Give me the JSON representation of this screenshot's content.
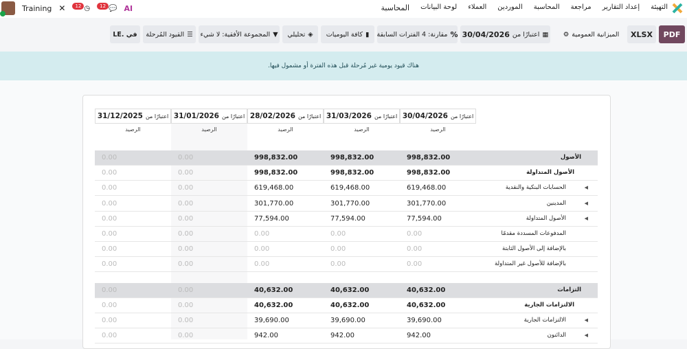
{
  "nav": {
    "app": "المحاسبة",
    "items": [
      "لوحة البيانات",
      "العملاء",
      "الموردين",
      "المحاسبة",
      "مراجعة",
      "إعداد التقارير",
      "التهيئة"
    ]
  },
  "systray": {
    "company": "Training",
    "activity_count": "12",
    "messages_count": "12",
    "ai": "AI"
  },
  "controls": {
    "pdf": "PDF",
    "xlsx": "XLSX",
    "report": "الميزانية العمومية",
    "date": "30/04/2026",
    "date_prefix": "اعتبارًا من",
    "comparison": "مقارنة: 4 الفترات السابقة",
    "journals": "كافة اليوميات",
    "analytic": "تحليلي",
    "horizontal_group": "المجموعة الأفقية: لا شيء",
    "posted": "القيود المُرحلة",
    "currency": "في .LE"
  },
  "banner": "هناك قيود يومية غير مُرحلة قبل هذه الفترة أو مشمول فيها.",
  "columns": [
    {
      "prefix": "اعتبارًا من",
      "date": "30/04/2026",
      "sub": "الرصيد"
    },
    {
      "prefix": "اعتبارًا من",
      "date": "31/03/2026",
      "sub": "الرصيد"
    },
    {
      "prefix": "اعتبارًا من",
      "date": "28/02/2026",
      "sub": "الرصيد"
    },
    {
      "prefix": "اعتبارًا من",
      "date": "31/01/2026",
      "sub": "الرصيد"
    },
    {
      "prefix": "اعتبارًا من",
      "date": "31/12/2025",
      "sub": "الرصيد"
    }
  ],
  "rows": [
    {
      "label": "الأصول",
      "type": "g",
      "values": [
        "998,832.00",
        "998,832.00",
        "998,832.00",
        "0.00",
        "0.00"
      ]
    },
    {
      "label": "الأصول المتداولة",
      "type": "b",
      "values": [
        "998,832.00",
        "998,832.00",
        "998,832.00",
        "0.00",
        "0.00"
      ]
    },
    {
      "label": "الحسابات البنكية والنقدية",
      "type": "i",
      "caret": true,
      "values": [
        "619,468.00",
        "619,468.00",
        "619,468.00",
        "0.00",
        "0.00"
      ]
    },
    {
      "label": "المدينين",
      "type": "i",
      "caret": true,
      "values": [
        "301,770.00",
        "301,770.00",
        "301,770.00",
        "0.00",
        "0.00"
      ]
    },
    {
      "label": "الأصول المتداولة",
      "type": "i",
      "caret": true,
      "values": [
        "77,594.00",
        "77,594.00",
        "77,594.00",
        "0.00",
        "0.00"
      ]
    },
    {
      "label": "المدفوعات المسددة مقدمًا",
      "type": "i",
      "values": [
        "0.00",
        "0.00",
        "0.00",
        "0.00",
        "0.00"
      ]
    },
    {
      "label": "بالإضافة إلى الأصول الثابتة",
      "type": "i",
      "values": [
        "0.00",
        "0.00",
        "0.00",
        "0.00",
        "0.00"
      ]
    },
    {
      "label": "بالإضافة للأصول غير المتداولة",
      "type": "i",
      "values": [
        "0.00",
        "0.00",
        "0.00",
        "0.00",
        "0.00"
      ]
    },
    {
      "label": "التزامات",
      "type": "g",
      "values": [
        "40,632.00",
        "40,632.00",
        "40,632.00",
        "0.00",
        "0.00"
      ]
    },
    {
      "label": "الالتزامات الجارية",
      "type": "b",
      "values": [
        "40,632.00",
        "40,632.00",
        "40,632.00",
        "0.00",
        "0.00"
      ]
    },
    {
      "label": "الالتزامات الجارية",
      "type": "i",
      "caret": true,
      "values": [
        "39,690.00",
        "39,690.00",
        "39,690.00",
        "0.00",
        "0.00"
      ]
    },
    {
      "label": "الدائنون",
      "type": "i",
      "caret": true,
      "values": [
        "942.00",
        "942.00",
        "942.00",
        "0.00",
        "0.00"
      ]
    }
  ]
}
